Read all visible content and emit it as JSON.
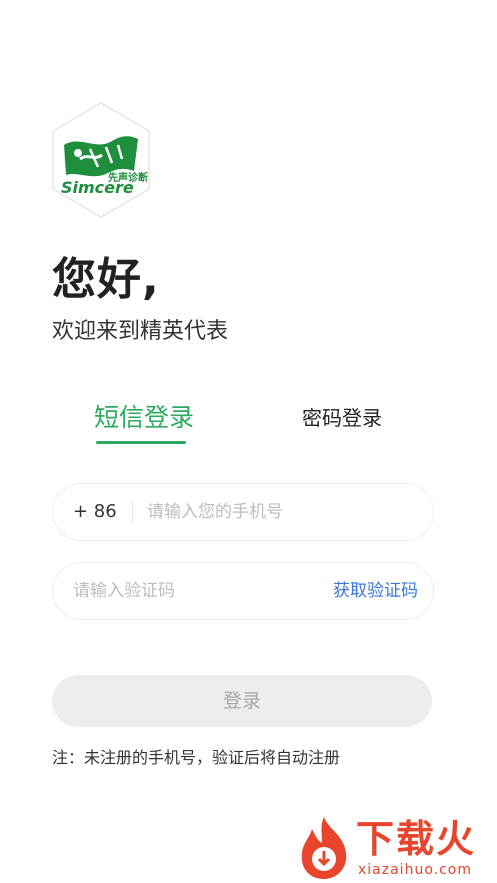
{
  "brand": {
    "logo_cn": "先声诊断",
    "logo_en": "Simcere",
    "color": "#1f8e3d"
  },
  "greeting": {
    "title": "您好,",
    "subtitle": "欢迎来到精英代表"
  },
  "tabs": [
    {
      "label": "短信登录",
      "active": true
    },
    {
      "label": "密码登录",
      "active": false
    }
  ],
  "accent_color": "#2daa5f",
  "phone": {
    "country_code": "+ 86",
    "placeholder": "请输入您的手机号",
    "value": ""
  },
  "code": {
    "placeholder": "请输入验证码",
    "value": "",
    "get_code_label": "获取验证码"
  },
  "login_button": "登录",
  "note": "注：未注册的手机号，验证后将自动注册",
  "watermark": {
    "title": "下载火",
    "url": "xiazaihuo.com",
    "color": "#e8452c"
  }
}
